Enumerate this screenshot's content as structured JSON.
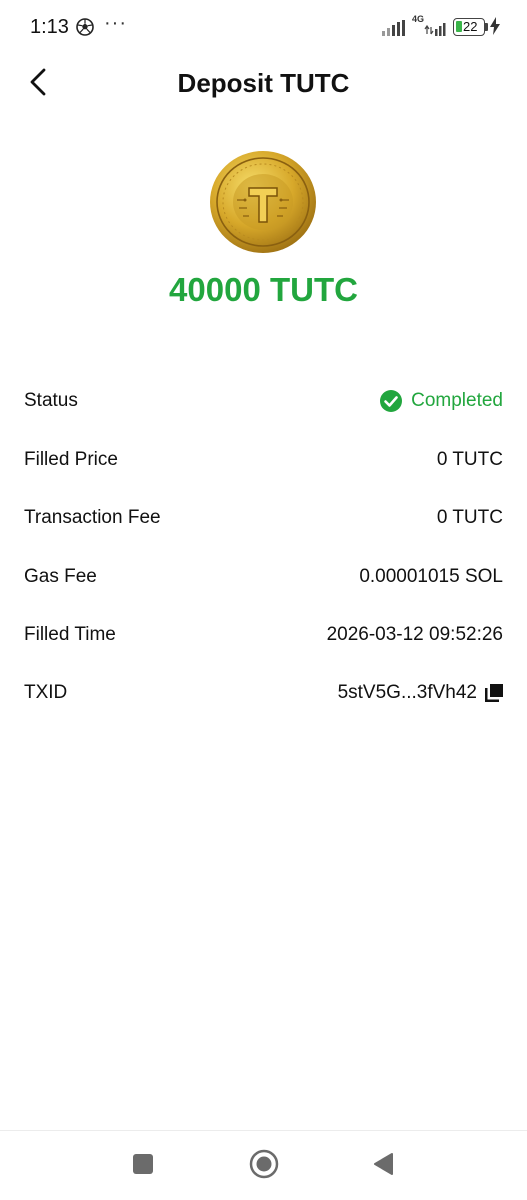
{
  "status_bar": {
    "time": "1:13",
    "dots": "···",
    "network": "4G",
    "battery": "22"
  },
  "header": {
    "title": "Deposit TUTC",
    "back_icon": "chevron-left-icon"
  },
  "token": {
    "logo": "tutc-coin-logo",
    "amount": "40000 TUTC"
  },
  "details": {
    "rows": [
      {
        "label": "Status",
        "value": "Completed",
        "icon": "check-circle-icon"
      },
      {
        "label": "Filled Price",
        "value": "0 TUTC"
      },
      {
        "label": "Transaction Fee",
        "value": "0 TUTC"
      },
      {
        "label": "Gas Fee",
        "value": "0.00001015 SOL"
      },
      {
        "label": "Filled Time",
        "value": "2026-03-12 09:52:26"
      },
      {
        "label": "TXID",
        "value": "5stV5G...3fVh42",
        "icon": "copy-icon"
      }
    ]
  },
  "colors": {
    "accent": "#22a63e",
    "text": "#111111",
    "coin": "#d4a827"
  },
  "nav_bar": {
    "icons": [
      "recents-square-icon",
      "home-circle-icon",
      "back-triangle-icon"
    ]
  }
}
